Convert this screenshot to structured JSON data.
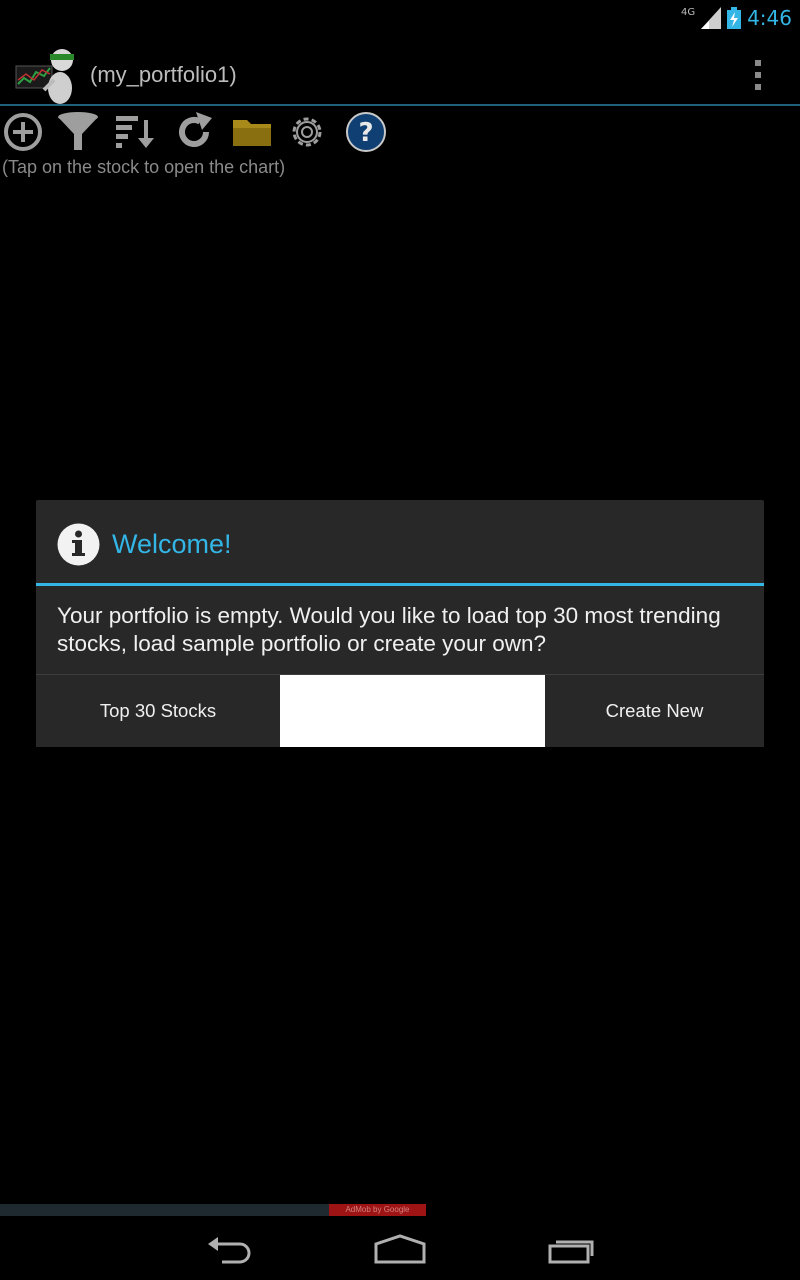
{
  "status_bar": {
    "network": "4G",
    "time": "4:46"
  },
  "action_bar": {
    "title": "(my_portfolio1)"
  },
  "toolbar": {
    "icons": [
      "add-icon",
      "filter-icon",
      "sort-icon",
      "refresh-icon",
      "folder-icon",
      "settings-icon",
      "help-icon"
    ]
  },
  "hint": "(Tap on the stock to open the chart)",
  "dialog": {
    "title": "Welcome!",
    "message": "Your portfolio is empty. Would you like to load top 30 most trending stocks, load sample portfolio or create your own?",
    "buttons": {
      "top30": "Top 30 Stocks",
      "sample": "",
      "create": "Create New"
    }
  },
  "ad": {
    "label": "AdMob by Google"
  },
  "colors": {
    "accent": "#33b5e5",
    "dialog_bg": "#282828",
    "background": "#000000"
  }
}
